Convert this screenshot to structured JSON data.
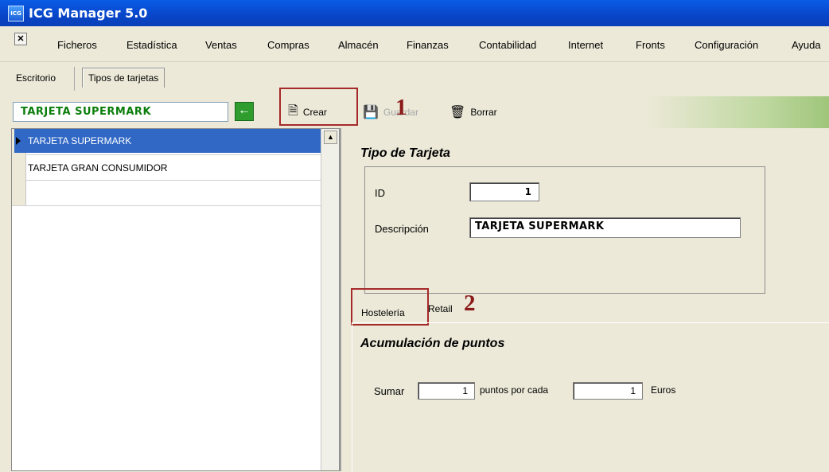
{
  "titlebar": {
    "app_title": "ICG Manager 5.0",
    "icon_label": "ICG"
  },
  "menu": {
    "close_glyph": "✕",
    "items": [
      "Ficheros",
      "Estadística",
      "Ventas",
      "Compras",
      "Almacén",
      "Finanzas",
      "Contabilidad",
      "Internet",
      "Fronts",
      "Configuración",
      "Ayuda"
    ]
  },
  "tabs": {
    "items": [
      "Escritorio",
      "Tipos de tarjetas"
    ],
    "active": "Tipos de tarjetas"
  },
  "toolbar": {
    "search_value": "TARJETA SUPERMARK",
    "arrow_icon": "green-left-arrow-icon",
    "crear": "Crear",
    "guardar": "Guardar",
    "borrar": "Borrar"
  },
  "annotations": {
    "marker1": "1",
    "marker2": "2",
    "highlight_color": "#a52a2a"
  },
  "list": {
    "rows": [
      "TARJETA SUPERMARK",
      "TARJETA GRAN CONSUMIDOR",
      ""
    ],
    "selected_index": 0
  },
  "detail": {
    "section_title": "Tipo de Tarjeta",
    "id_label": "ID",
    "id_value": "1",
    "desc_label": "Descripción",
    "desc_value": "TARJETA SUPERMARK"
  },
  "subtabs": {
    "items": [
      "Hostelería",
      "Retail"
    ],
    "active": "Hostelería"
  },
  "puntos": {
    "title": "Acumulación de puntos",
    "sumar_label": "Sumar",
    "sumar_value": "1",
    "puntos_label": "puntos por cada",
    "euros_value": "1",
    "euros_label": "Euros"
  },
  "colors": {
    "selection": "#3168c5",
    "accent_green": "#0a7d0a",
    "title_blue": "#0845c8"
  }
}
